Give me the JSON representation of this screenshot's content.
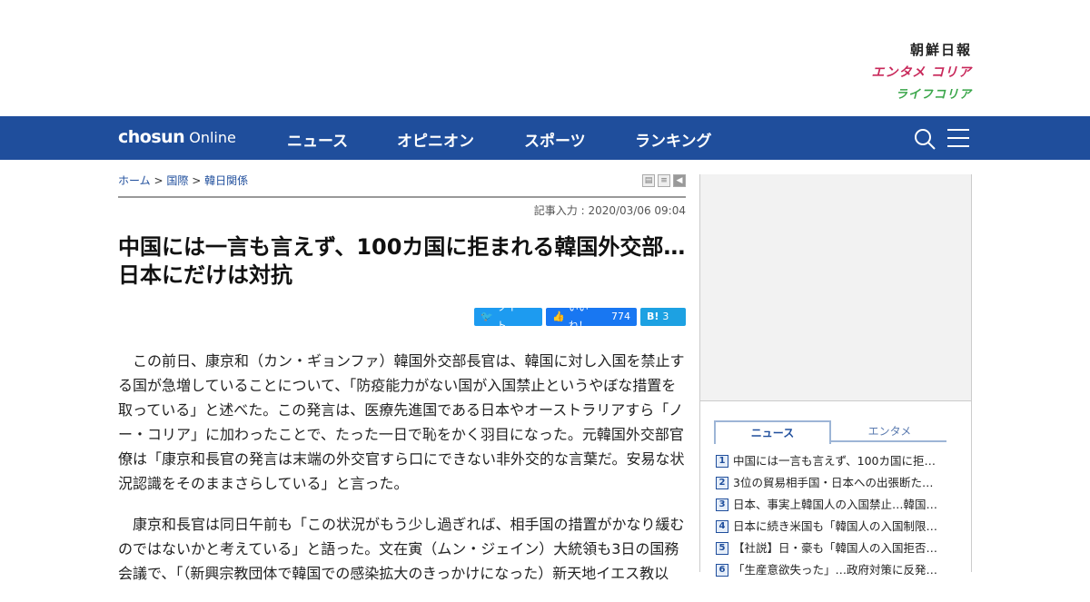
{
  "header": {
    "brand_chosun": "朝鮮日報",
    "brand_entame": "エンタメ コリア",
    "brand_life": "ライフコリア"
  },
  "nav": {
    "logo_bold": "chosun",
    "logo_light": "Online",
    "items": [
      "ニュース",
      "オピニオン",
      "スポーツ",
      "ランキング"
    ],
    "bg_color": "#1f4e9c"
  },
  "article": {
    "breadcrumb": {
      "home": "ホーム",
      "sep": ">",
      "section": "国際",
      "subsection": "韓日関係"
    },
    "dateline": "記事入力 : 2020/03/06 09:04",
    "headline": "中国には一言も言えず、100カ国に拒まれる韓国外交部…日本にだけは対抗",
    "share": {
      "tweet": "ツイート",
      "like": "いいね！",
      "like_count": "774",
      "hatena": "B!",
      "hatena_count": "3"
    },
    "paragraphs": [
      "この前日、康京和（カン・ギョンファ）韓国外交部長官は、韓国に対し入国を禁止する国が急増していることについて、「防疫能力がない国が入国禁止というやぼな措置を取っている」と述べた。この発言は、医療先進国である日本やオーストラリアすら「ノー・コリア」に加わったことで、たった一日で恥をかく羽目になった。元韓国外交部官僚は「康京和長官の発言は末端の外交官すら口にできない非外交的な言葉だ。安易な状況認識をそのままさらしている」と言った。",
      "康京和長官は同日午前も「この状況がもう少し過ぎれば、相手国の措置がかなり緩むのではないかと考えている」と語った。文在寅（ムン・ジェイン）大統領も3日の国務会議で、「（新興宗教団体で韓国での感染拡大のきっかけになった）新天地イエス教以"
    ]
  },
  "sidebar": {
    "tabs": [
      "ニュース",
      "エンタメ"
    ],
    "ranking": [
      {
        "num": "1",
        "title": "中国には一言も言えず、100カ国に拒…"
      },
      {
        "num": "2",
        "title": "3位の貿易相手国・日本への出張断た…"
      },
      {
        "num": "3",
        "title": "日本、事実上韓国人の入国禁止…韓国…"
      },
      {
        "num": "4",
        "title": "日本に続き米国も「韓国人の入国制限…"
      },
      {
        "num": "5",
        "title": "【社説】日・豪も「韓国人の入国拒否…"
      },
      {
        "num": "6",
        "title": "「生産意欲失った」…政府対策に反発…"
      }
    ]
  }
}
